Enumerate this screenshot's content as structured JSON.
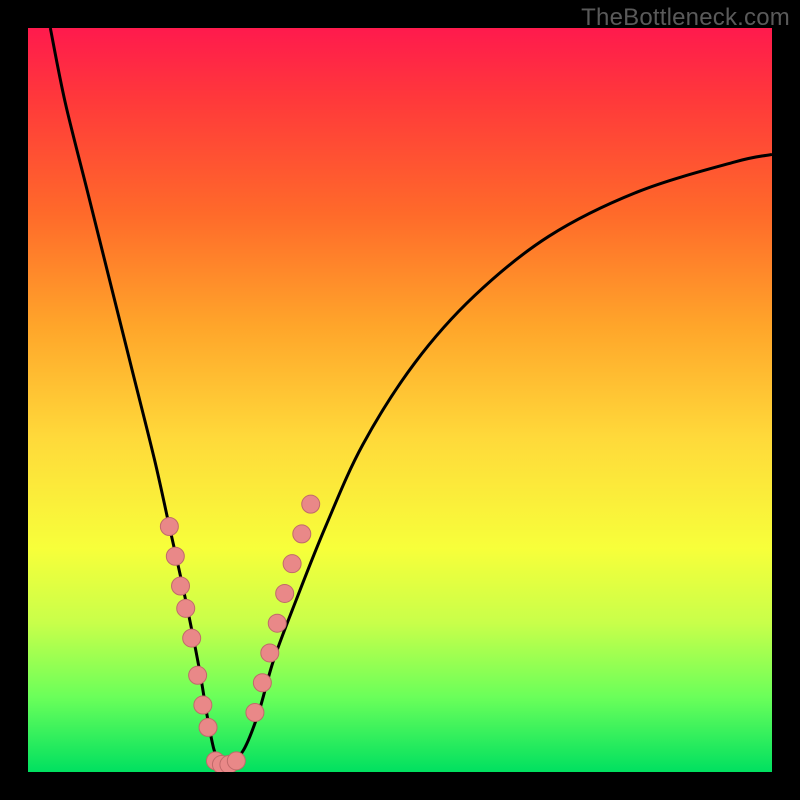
{
  "watermark": "TheBottleneck.com",
  "colors": {
    "curve": "#000000",
    "marker_fill": "#e98888",
    "marker_stroke": "#c06a6a",
    "background_top": "#ff1a4d",
    "background_bottom": "#00e060"
  },
  "chart_data": {
    "type": "line",
    "title": "",
    "xlabel": "",
    "ylabel": "",
    "xlim": [
      0,
      100
    ],
    "ylim": [
      0,
      100
    ],
    "series": [
      {
        "name": "bottleneck-curve",
        "x": [
          3,
          5,
          8,
          11,
          14,
          17,
          19,
          21,
          23,
          24,
          25,
          26,
          27,
          29,
          31,
          33,
          36,
          40,
          45,
          52,
          60,
          70,
          82,
          95,
          100
        ],
        "values": [
          100,
          90,
          78,
          66,
          54,
          42,
          33,
          24,
          14,
          8,
          3,
          1,
          1,
          3,
          8,
          15,
          23,
          33,
          44,
          55,
          64,
          72,
          78,
          82,
          83
        ]
      },
      {
        "name": "markers-left",
        "x": [
          19.0,
          19.8,
          20.5,
          21.2,
          22.0,
          22.8,
          23.5,
          24.2
        ],
        "values": [
          33,
          29,
          25,
          22,
          18,
          13,
          9,
          6
        ]
      },
      {
        "name": "markers-bottom",
        "x": [
          25.2,
          26.0,
          27.0,
          28.0
        ],
        "values": [
          1.5,
          1.0,
          1.0,
          1.5
        ]
      },
      {
        "name": "markers-right",
        "x": [
          30.5,
          31.5,
          32.5,
          33.5,
          34.5,
          35.5,
          36.8,
          38.0
        ],
        "values": [
          8,
          12,
          16,
          20,
          24,
          28,
          32,
          36
        ]
      }
    ]
  }
}
